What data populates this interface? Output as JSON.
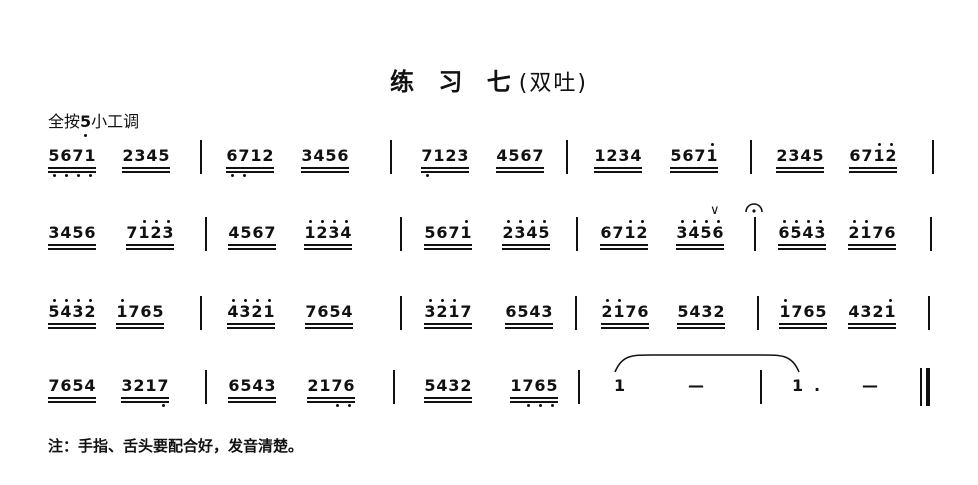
{
  "title": {
    "main": "练 习 七",
    "sub": "(双吐)"
  },
  "key": {
    "prefix": "全按",
    "note": "5",
    "suffix": "小工调"
  },
  "footer": "注：手指、舌头要配合好，发音清楚。",
  "rows": [
    {
      "groups": [
        {
          "notes": [
            [
              "5",
              "lo"
            ],
            [
              "6",
              "lo"
            ],
            [
              "7",
              "lo"
            ],
            [
              "1",
              "lo"
            ]
          ]
        },
        {
          "notes": [
            [
              "2",
              ""
            ],
            [
              "3",
              ""
            ],
            [
              "4",
              ""
            ],
            [
              "5",
              ""
            ]
          ]
        },
        {
          "notes": [
            [
              "6",
              "lo"
            ],
            [
              "7",
              "lo"
            ],
            [
              "1",
              ""
            ],
            [
              "2",
              ""
            ]
          ]
        },
        {
          "notes": [
            [
              "3",
              ""
            ],
            [
              "4",
              ""
            ],
            [
              "5",
              ""
            ],
            [
              "6",
              ""
            ]
          ]
        },
        {
          "notes": [
            [
              "7",
              "lo"
            ],
            [
              "1",
              ""
            ],
            [
              "2",
              ""
            ],
            [
              "3",
              ""
            ]
          ]
        },
        {
          "notes": [
            [
              "4",
              ""
            ],
            [
              "5",
              ""
            ],
            [
              "6",
              ""
            ],
            [
              "7",
              ""
            ]
          ]
        },
        {
          "notes": [
            [
              "1",
              ""
            ],
            [
              "2",
              ""
            ],
            [
              "3",
              ""
            ],
            [
              "4",
              ""
            ]
          ]
        },
        {
          "notes": [
            [
              "5",
              ""
            ],
            [
              "6",
              ""
            ],
            [
              "7",
              ""
            ],
            [
              "1",
              "hi"
            ]
          ]
        },
        {
          "notes": [
            [
              "2",
              ""
            ],
            [
              "3",
              ""
            ],
            [
              "4",
              ""
            ],
            [
              "5",
              ""
            ]
          ]
        },
        {
          "notes": [
            [
              "6",
              ""
            ],
            [
              "7",
              ""
            ],
            [
              "1",
              "hi"
            ],
            [
              "2",
              "hi"
            ]
          ]
        }
      ]
    },
    {
      "groups": [
        {
          "notes": [
            [
              "3",
              ""
            ],
            [
              "4",
              ""
            ],
            [
              "5",
              ""
            ],
            [
              "6",
              ""
            ]
          ]
        },
        {
          "notes": [
            [
              "7",
              ""
            ],
            [
              "1",
              "hi"
            ],
            [
              "2",
              "hi"
            ],
            [
              "3",
              "hi"
            ]
          ]
        },
        {
          "notes": [
            [
              "4",
              ""
            ],
            [
              "5",
              ""
            ],
            [
              "6",
              ""
            ],
            [
              "7",
              ""
            ]
          ]
        },
        {
          "notes": [
            [
              "1",
              "hi"
            ],
            [
              "2",
              "hi"
            ],
            [
              "3",
              "hi"
            ],
            [
              "4",
              "hi"
            ]
          ]
        },
        {
          "notes": [
            [
              "5",
              ""
            ],
            [
              "6",
              ""
            ],
            [
              "7",
              ""
            ],
            [
              "1",
              "hi"
            ]
          ]
        },
        {
          "notes": [
            [
              "2",
              "hi"
            ],
            [
              "3",
              "hi"
            ],
            [
              "4",
              "hi"
            ],
            [
              "5",
              "hi"
            ]
          ]
        },
        {
          "notes": [
            [
              "6",
              ""
            ],
            [
              "7",
              ""
            ],
            [
              "1",
              "hi"
            ],
            [
              "2",
              "hi"
            ]
          ]
        },
        {
          "notes": [
            [
              "3",
              "hi"
            ],
            [
              "4",
              "hi"
            ],
            [
              "5",
              "hi"
            ],
            [
              "6",
              "hi"
            ]
          ]
        },
        {
          "notes": [
            [
              "6",
              "hi"
            ],
            [
              "5",
              "hi"
            ],
            [
              "4",
              "hi"
            ],
            [
              "3",
              "hi"
            ]
          ]
        },
        {
          "notes": [
            [
              "2",
              "hi"
            ],
            [
              "1",
              "hi"
            ],
            [
              "7",
              ""
            ],
            [
              "6",
              ""
            ]
          ]
        }
      ]
    },
    {
      "groups": [
        {
          "notes": [
            [
              "5",
              "hi"
            ],
            [
              "4",
              "hi"
            ],
            [
              "3",
              "hi"
            ],
            [
              "2",
              "hi"
            ]
          ]
        },
        {
          "notes": [
            [
              "1",
              "hi"
            ],
            [
              "7",
              ""
            ],
            [
              "6",
              ""
            ],
            [
              "5",
              ""
            ]
          ]
        },
        {
          "notes": [
            [
              "4",
              "hi"
            ],
            [
              "3",
              "hi"
            ],
            [
              "2",
              "hi"
            ],
            [
              "1",
              "hi"
            ]
          ]
        },
        {
          "notes": [
            [
              "7",
              ""
            ],
            [
              "6",
              ""
            ],
            [
              "5",
              ""
            ],
            [
              "4",
              ""
            ]
          ]
        },
        {
          "notes": [
            [
              "3",
              "hi"
            ],
            [
              "2",
              "hi"
            ],
            [
              "1",
              "hi"
            ],
            [
              "7",
              ""
            ]
          ]
        },
        {
          "notes": [
            [
              "6",
              ""
            ],
            [
              "5",
              ""
            ],
            [
              "4",
              ""
            ],
            [
              "3",
              ""
            ]
          ]
        },
        {
          "notes": [
            [
              "2",
              "hi"
            ],
            [
              "1",
              "hi"
            ],
            [
              "7",
              ""
            ],
            [
              "6",
              ""
            ]
          ]
        },
        {
          "notes": [
            [
              "5",
              ""
            ],
            [
              "4",
              ""
            ],
            [
              "3",
              ""
            ],
            [
              "2",
              ""
            ]
          ]
        },
        {
          "notes": [
            [
              "1",
              "hi"
            ],
            [
              "7",
              ""
            ],
            [
              "6",
              ""
            ],
            [
              "5",
              ""
            ]
          ]
        },
        {
          "notes": [
            [
              "4",
              ""
            ],
            [
              "3",
              ""
            ],
            [
              "2",
              ""
            ],
            [
              "1",
              "hi"
            ]
          ]
        }
      ]
    },
    {
      "groups": [
        {
          "notes": [
            [
              "7",
              ""
            ],
            [
              "6",
              ""
            ],
            [
              "5",
              ""
            ],
            [
              "4",
              ""
            ]
          ]
        },
        {
          "notes": [
            [
              "3",
              ""
            ],
            [
              "2",
              ""
            ],
            [
              "1",
              ""
            ],
            [
              "7",
              "lo"
            ]
          ]
        },
        {
          "notes": [
            [
              "6",
              ""
            ],
            [
              "5",
              ""
            ],
            [
              "4",
              ""
            ],
            [
              "3",
              ""
            ]
          ]
        },
        {
          "notes": [
            [
              "2",
              ""
            ],
            [
              "1",
              ""
            ],
            [
              "7",
              "lo"
            ],
            [
              "6",
              "lo"
            ]
          ]
        },
        {
          "notes": [
            [
              "5",
              ""
            ],
            [
              "4",
              ""
            ],
            [
              "3",
              ""
            ],
            [
              "2",
              ""
            ]
          ]
        },
        {
          "notes": [
            [
              "1",
              ""
            ],
            [
              "7",
              "lo"
            ],
            [
              "6",
              "lo"
            ],
            [
              "5",
              "lo"
            ]
          ]
        }
      ],
      "ending": {
        "n1": "1",
        "dash1": "—",
        "n2": "1",
        "aug": ".",
        "dash2": "—"
      }
    }
  ],
  "marks": {
    "breath": "∨"
  }
}
